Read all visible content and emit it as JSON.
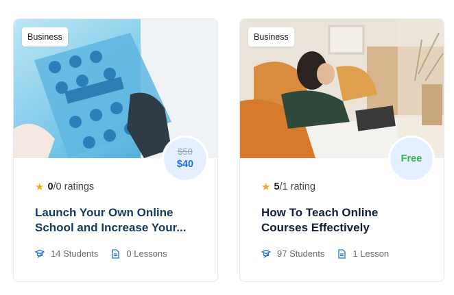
{
  "courses": [
    {
      "category": "Business",
      "price_old": "$50",
      "price": "$40",
      "rating_score": "0",
      "rating_text": "/0 ratings",
      "title": "Launch Your Own Online School and Increase Your...",
      "students": "14 Students",
      "lessons": "0 Lessons"
    },
    {
      "category": "Business",
      "price": "Free",
      "rating_score": "5",
      "rating_text": "/1 rating",
      "title": "How To Teach Online Courses Effectively",
      "students": "97 Students",
      "lessons": "1 Lesson"
    }
  ],
  "colors": {
    "accent": "#1e73d8",
    "free": "#3bb34a",
    "star": "#f5a623"
  },
  "icons": {
    "star": "star-icon",
    "students": "graduation-cap-icon",
    "lessons": "document-icon"
  }
}
